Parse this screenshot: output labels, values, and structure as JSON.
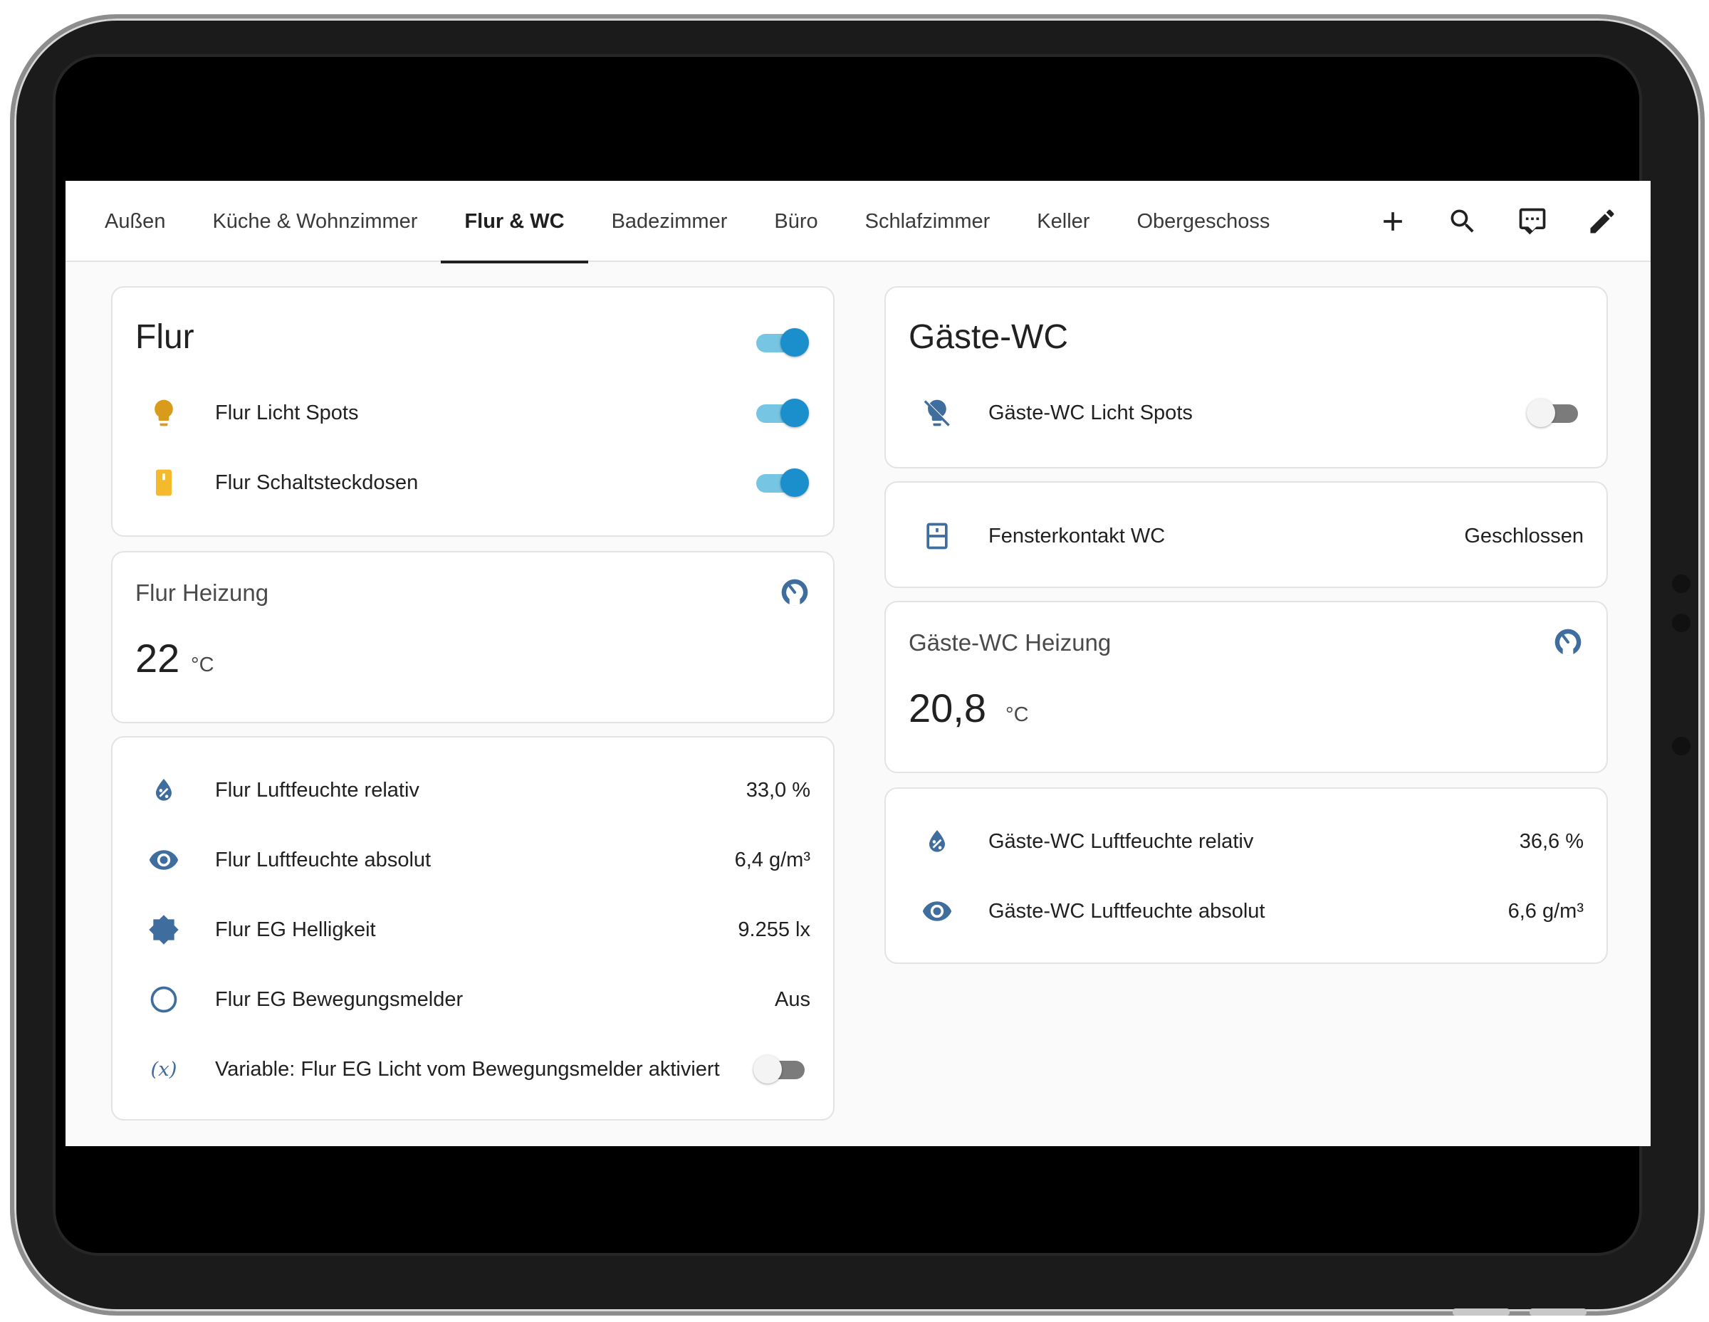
{
  "tabs": [
    {
      "label": "Außen"
    },
    {
      "label": "Küche & Wohnzimmer"
    },
    {
      "label": "Flur & WC",
      "active": true
    },
    {
      "label": "Badezimmer"
    },
    {
      "label": "Büro"
    },
    {
      "label": "Schlafzimmer"
    },
    {
      "label": "Keller"
    },
    {
      "label": "Obergeschoss"
    }
  ],
  "toolbar_icons": [
    "plus-icon",
    "search-icon",
    "chat-icon",
    "pencil-icon"
  ],
  "colors": {
    "accent_on": "#1a8fcc",
    "track_on": "#76c5e3",
    "icon_blue": "#3f6d9e",
    "bulb_on": "#d89b1c",
    "outlet_on": "#f5b92c"
  },
  "flur_card": {
    "title": "Flur",
    "master_toggle": "on",
    "rows": [
      {
        "icon": "lightbulb-icon",
        "label": "Flur Licht Spots",
        "state": "on"
      },
      {
        "icon": "outlet-icon",
        "label": "Flur Schaltsteckdosen",
        "state": "on"
      }
    ]
  },
  "flur_heizung": {
    "name": "Flur Heizung",
    "value": "22",
    "unit": "°C",
    "icon": "thermostat-gauge-icon"
  },
  "flur_sensors": [
    {
      "icon": "water-percent-icon",
      "label": "Flur Luftfeuchte relativ",
      "value": "33,0 %"
    },
    {
      "icon": "eye-icon",
      "label": "Flur Luftfeuchte absolut",
      "value": "6,4 g/m³"
    },
    {
      "icon": "brightness-icon",
      "label": "Flur EG Helligkeit",
      "value": "9.255 lx"
    },
    {
      "icon": "circle-outline-icon",
      "label": "Flur EG Bewegungsmelder",
      "value": "Aus"
    },
    {
      "icon": "variable-icon",
      "label": "Variable: Flur EG Licht vom Bewegungsmelder aktiviert",
      "state": "off"
    }
  ],
  "gaeste_card": {
    "title": "Gäste-WC",
    "rows": [
      {
        "icon": "lightbulb-off-icon",
        "label": "Gäste-WC Licht Spots",
        "state": "off"
      }
    ]
  },
  "fenster": {
    "icon": "window-closed-icon",
    "label": "Fensterkontakt WC",
    "value": "Geschlossen"
  },
  "gaeste_heizung": {
    "name": "Gäste-WC Heizung",
    "value": "20,8",
    "unit": "°C",
    "icon": "thermostat-gauge-icon"
  },
  "gaeste_sensors": [
    {
      "icon": "water-percent-icon",
      "label": "Gäste-WC Luftfeuchte relativ",
      "value": "36,6 %"
    },
    {
      "icon": "eye-icon",
      "label": "Gäste-WC Luftfeuchte absolut",
      "value": "6,6 g/m³"
    }
  ]
}
